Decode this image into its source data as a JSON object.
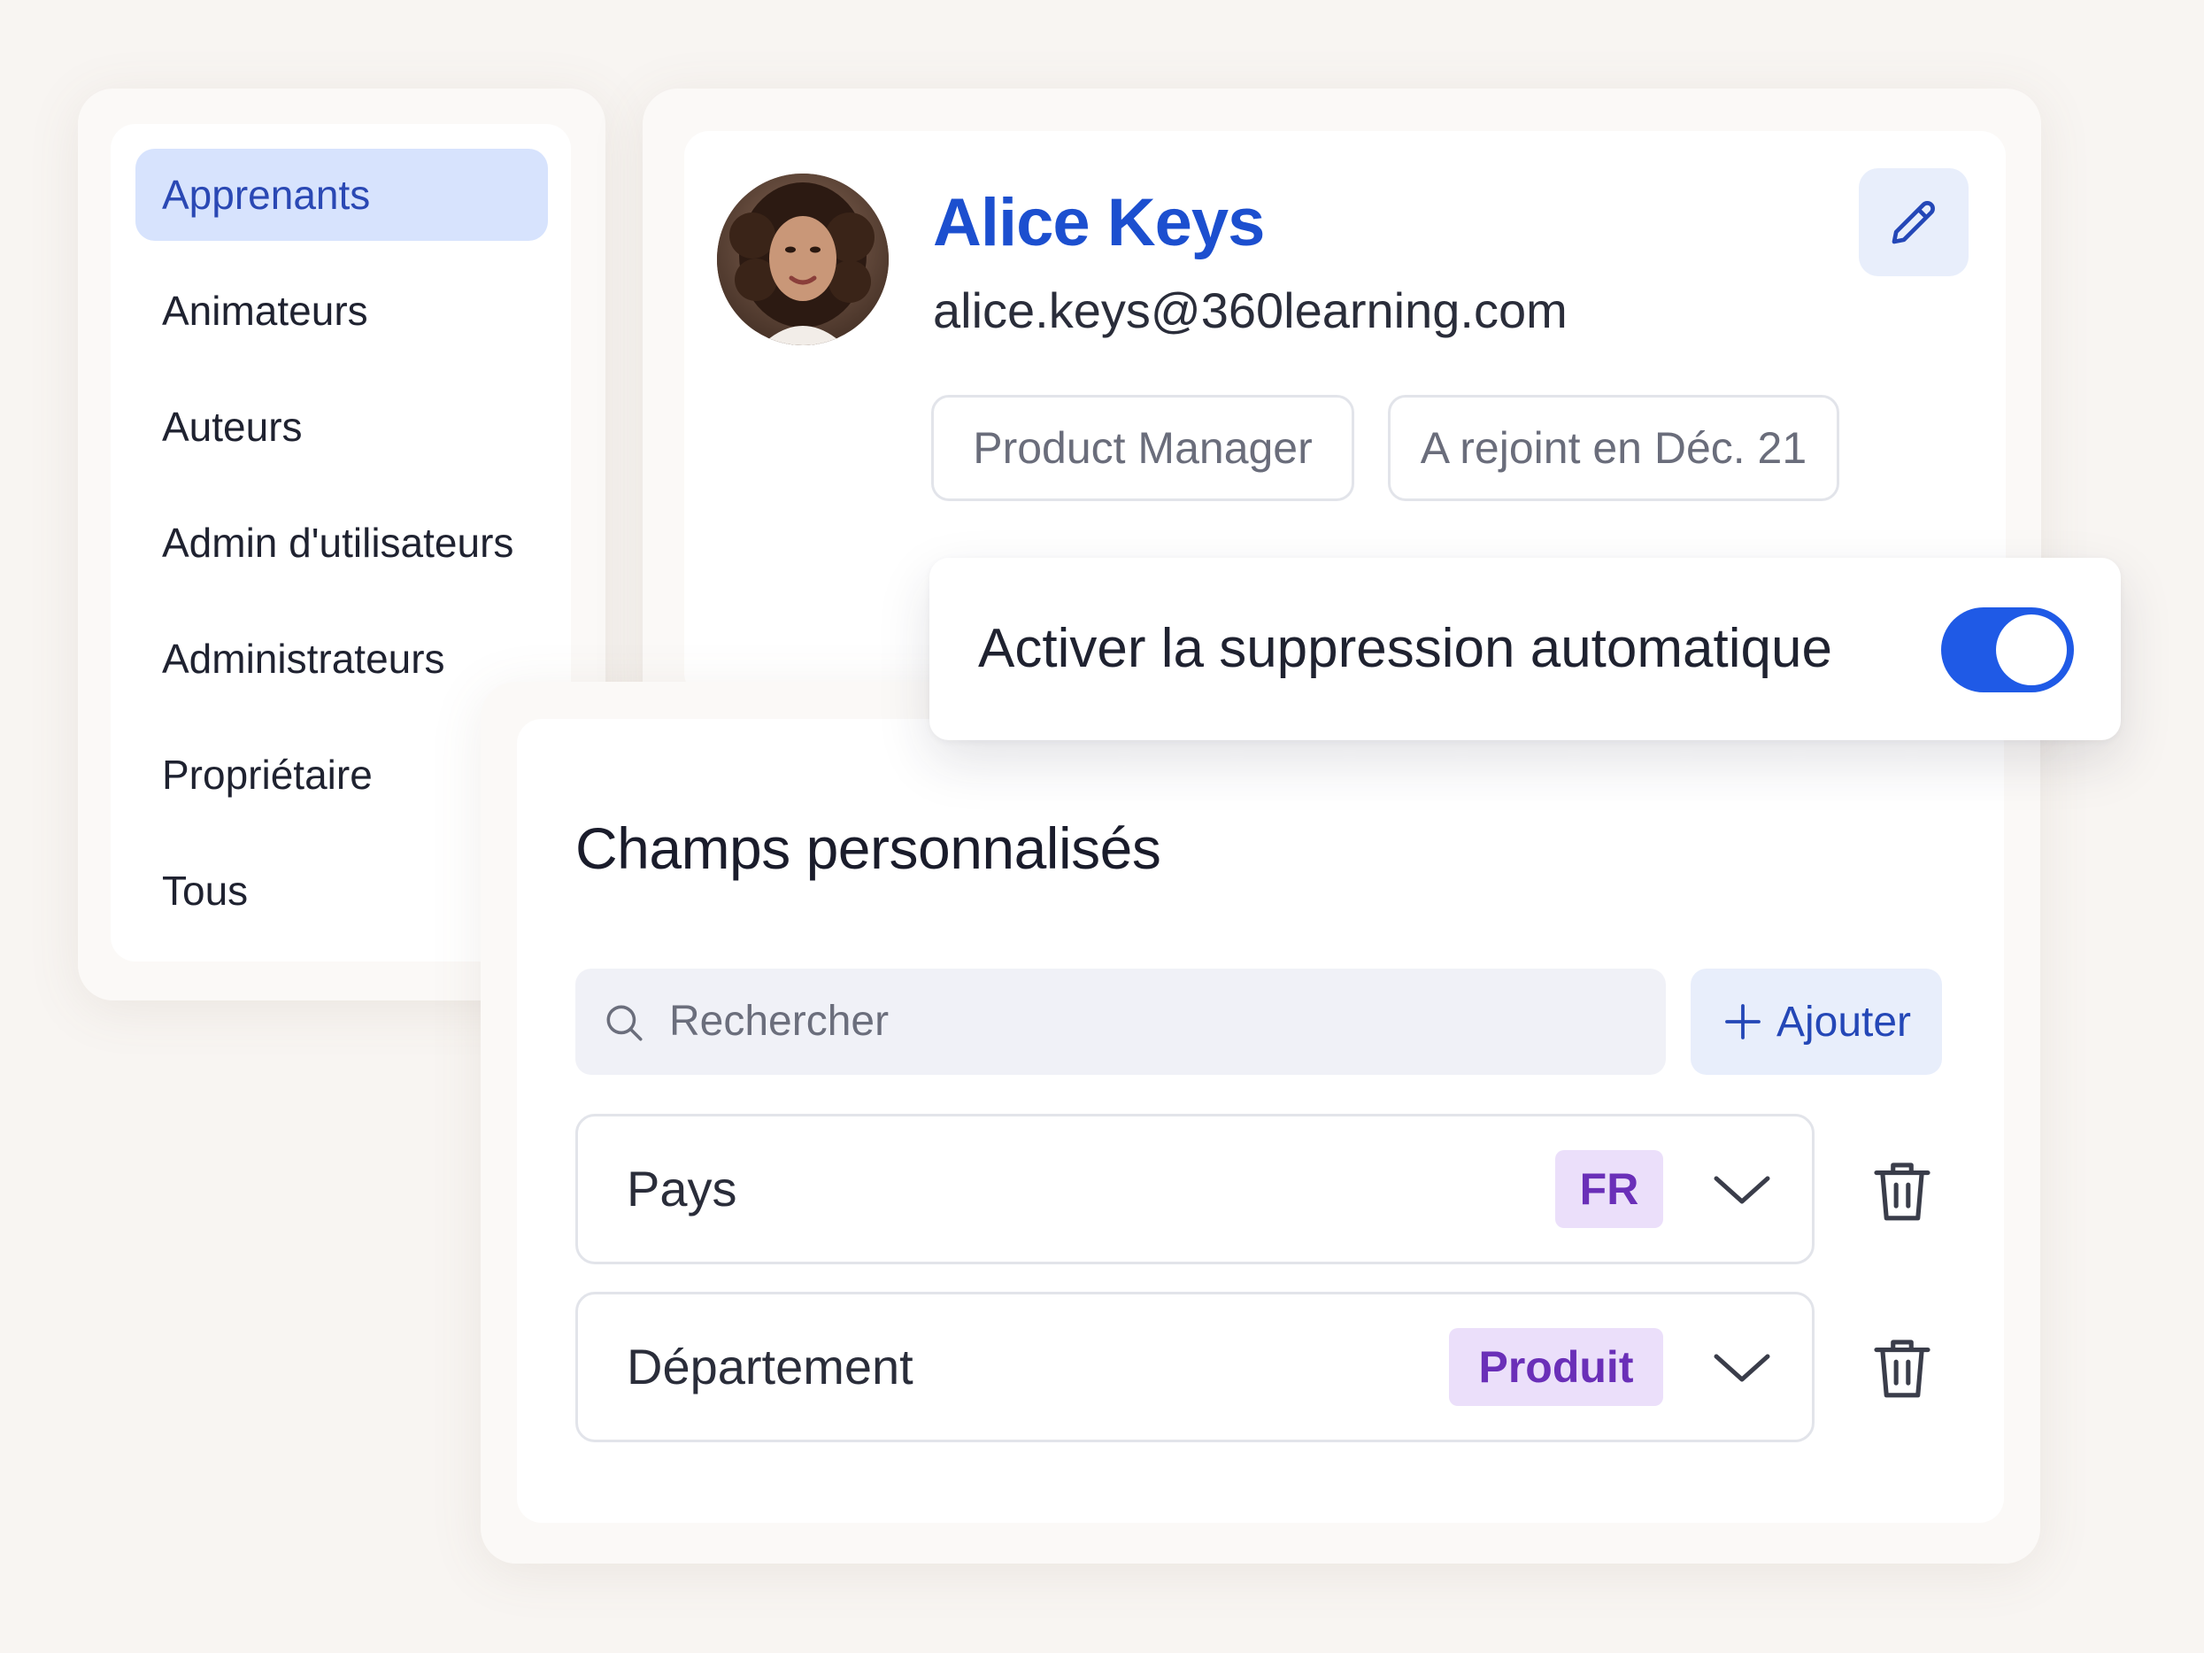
{
  "sidebar": {
    "items": [
      {
        "label": "Apprenants",
        "active": true
      },
      {
        "label": "Animateurs",
        "active": false
      },
      {
        "label": "Auteurs",
        "active": false
      },
      {
        "label": "Admin d'utilisateurs",
        "active": false
      },
      {
        "label": "Administrateurs",
        "active": false
      },
      {
        "label": "Propriétaire",
        "active": false
      },
      {
        "label": "Tous",
        "active": false
      }
    ]
  },
  "profile": {
    "name": "Alice Keys",
    "email": "alice.keys@360learning.com",
    "tags": [
      "Product Manager",
      "A rejoint en Déc. 21"
    ],
    "edit_icon": "pencil-icon"
  },
  "auto_delete": {
    "label": "Activer la suppression automatique",
    "enabled": true
  },
  "custom_fields": {
    "title": "Champs personnalisés",
    "search_placeholder": "Rechercher",
    "add_label": "Ajouter",
    "fields": [
      {
        "label": "Pays",
        "value": "FR"
      },
      {
        "label": "Département",
        "value": "Produit"
      }
    ]
  },
  "colors": {
    "accent": "#1f5ae6",
    "name_blue": "#1c4fcf",
    "active_nav_bg": "#d7e3fd",
    "badge_bg": "#ebdffa",
    "badge_text": "#6a2fb8"
  }
}
